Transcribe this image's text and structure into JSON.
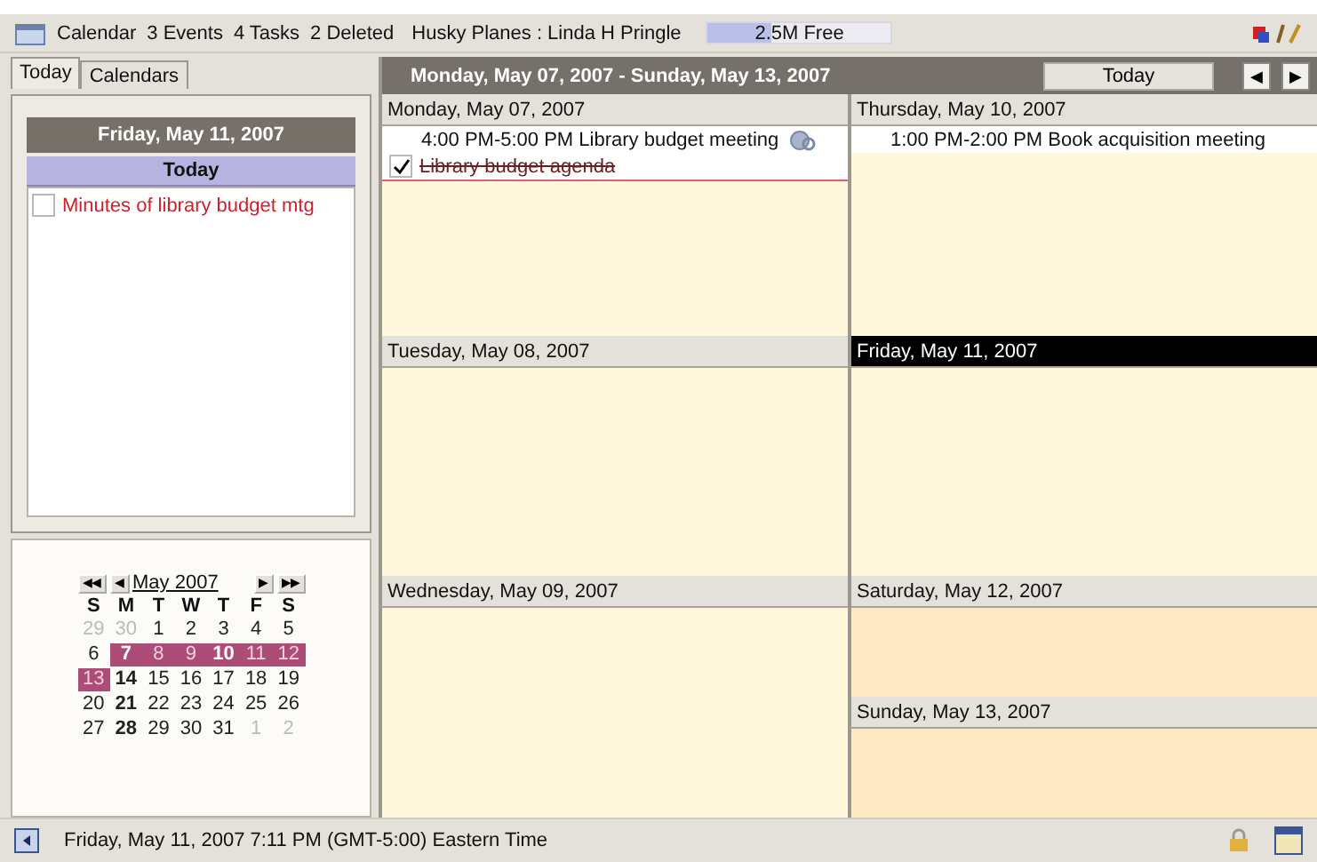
{
  "toolbar": {
    "app": "Calendar",
    "counts": [
      "3 Events",
      "4 Tasks",
      "2 Deleted"
    ],
    "account": "Husky Planes : Linda H Pringle",
    "storage": {
      "label": "2.5M Free",
      "level": 0.35
    }
  },
  "left_tabs": [
    {
      "label": "Today",
      "selected": true
    },
    {
      "label": "Calendars",
      "selected": false
    }
  ],
  "today_panel": {
    "date": "Friday, May 11, 2007",
    "heading": "Today",
    "tasks": [
      {
        "title": "Minutes of library budget mtg",
        "checked": false
      }
    ]
  },
  "mini_calendar": {
    "month": "May 2007",
    "prev_year": "◀◀",
    "prev": "◀",
    "next": "▶",
    "next_year": "▶▶",
    "weekdays": [
      "S",
      "M",
      "T",
      "W",
      "T",
      "F",
      "S"
    ],
    "days": [
      {
        "d": "29",
        "other": true,
        "bold": false,
        "marked": false
      },
      {
        "d": "30",
        "other": true,
        "bold": false,
        "marked": false
      },
      {
        "d": "1",
        "other": false,
        "bold": false,
        "marked": false
      },
      {
        "d": "2",
        "other": false,
        "bold": false,
        "marked": false
      },
      {
        "d": "3",
        "other": false,
        "bold": false,
        "marked": false
      },
      {
        "d": "4",
        "other": false,
        "bold": false,
        "marked": false
      },
      {
        "d": "5",
        "other": false,
        "bold": false,
        "marked": false
      },
      {
        "d": "6",
        "other": false,
        "bold": false,
        "marked": false
      },
      {
        "d": "7",
        "other": false,
        "bold": true,
        "marked": true
      },
      {
        "d": "8",
        "other": false,
        "bold": false,
        "marked": true
      },
      {
        "d": "9",
        "other": false,
        "bold": false,
        "marked": true
      },
      {
        "d": "10",
        "other": false,
        "bold": true,
        "marked": true
      },
      {
        "d": "11",
        "other": false,
        "bold": false,
        "marked": true
      },
      {
        "d": "12",
        "other": false,
        "bold": false,
        "marked": true
      },
      {
        "d": "13",
        "other": false,
        "bold": false,
        "marked": true
      },
      {
        "d": "14",
        "other": false,
        "bold": true,
        "marked": false
      },
      {
        "d": "15",
        "other": false,
        "bold": false,
        "marked": false
      },
      {
        "d": "16",
        "other": false,
        "bold": false,
        "marked": false
      },
      {
        "d": "17",
        "other": false,
        "bold": false,
        "marked": false
      },
      {
        "d": "18",
        "other": false,
        "bold": false,
        "marked": false
      },
      {
        "d": "19",
        "other": false,
        "bold": false,
        "marked": false
      },
      {
        "d": "20",
        "other": false,
        "bold": false,
        "marked": false
      },
      {
        "d": "21",
        "other": false,
        "bold": true,
        "marked": false
      },
      {
        "d": "22",
        "other": false,
        "bold": false,
        "marked": false
      },
      {
        "d": "23",
        "other": false,
        "bold": false,
        "marked": false
      },
      {
        "d": "24",
        "other": false,
        "bold": false,
        "marked": false
      },
      {
        "d": "25",
        "other": false,
        "bold": false,
        "marked": false
      },
      {
        "d": "26",
        "other": false,
        "bold": false,
        "marked": false
      },
      {
        "d": "27",
        "other": false,
        "bold": false,
        "marked": false
      },
      {
        "d": "28",
        "other": false,
        "bold": true,
        "marked": false
      },
      {
        "d": "29",
        "other": false,
        "bold": false,
        "marked": false
      },
      {
        "d": "30",
        "other": false,
        "bold": false,
        "marked": false
      },
      {
        "d": "31",
        "other": false,
        "bold": false,
        "marked": false
      },
      {
        "d": "1",
        "other": true,
        "bold": false,
        "marked": false
      },
      {
        "d": "2",
        "other": true,
        "bold": false,
        "marked": false
      }
    ]
  },
  "week": {
    "range": "Monday, May 07, 2007 - Sunday, May 13, 2007",
    "today_button": "Today",
    "prev": "◀",
    "next": "▶",
    "columns": [
      [
        {
          "label": "Monday, May 07, 2007",
          "selected": false,
          "weekend": false,
          "items": [
            {
              "kind": "event",
              "text": "4:00 PM-5:00 PM Library budget meeting",
              "recurring": true
            },
            {
              "kind": "task",
              "text": "Library budget agenda",
              "checked": true
            }
          ]
        },
        {
          "label": "Tuesday, May 08, 2007",
          "selected": false,
          "weekend": false
        },
        {
          "label": "Wednesday, May 09, 2007",
          "selected": false,
          "weekend": false
        }
      ],
      [
        {
          "label": "Thursday, May 10, 2007",
          "selected": false,
          "weekend": false,
          "items": [
            {
              "kind": "event",
              "text": "1:00 PM-2:00 PM Book acquisition meeting",
              "recurring": false
            }
          ]
        },
        {
          "label": "Friday, May 11, 2007",
          "selected": true,
          "weekend": false
        },
        {
          "label": "Saturday, May 12, 2007",
          "selected": false,
          "weekend": true
        },
        {
          "label": "Sunday, May 13, 2007",
          "selected": false,
          "weekend": true
        }
      ]
    ]
  },
  "status_bar": {
    "text": "Friday, May 11, 2007 7:11 PM (GMT-5:00) Eastern Time"
  }
}
